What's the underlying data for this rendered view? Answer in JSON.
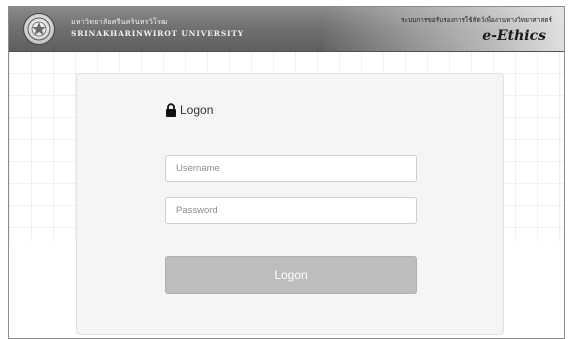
{
  "header": {
    "university_name_thai": "มหาวิทยาลัยศรีนครินทรวิโรฒ",
    "university_name_en": "SRINAKHARINWIROT UNIVERSITY",
    "system_title": "ระบบการขอรับรองการใช้สัตว์เพื่องานทางวิทยาศาสตร์",
    "brand": "e-Ethics",
    "logo_icon": "university-seal-icon"
  },
  "logon": {
    "title": "Logon",
    "title_icon": "lock-icon",
    "username_placeholder": "Username",
    "username_value": "",
    "password_placeholder": "Password",
    "password_value": "",
    "button_label": "Logon"
  },
  "colors": {
    "header_background": "#6f6f6f",
    "panel_background": "#f5f5f5",
    "button_background": "#bdbdbd",
    "button_text": "#ffffff"
  }
}
